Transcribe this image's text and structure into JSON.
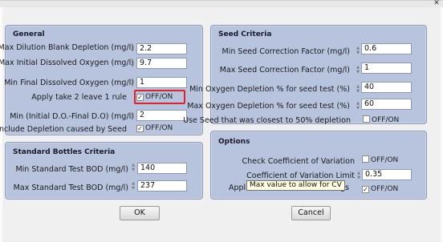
{
  "general": {
    "title": "General",
    "rows": [
      {
        "label": "Max Dilution Blank Depletion (mg/l)",
        "value": "2.2"
      },
      {
        "label": "Max Initial Dissolved Oxygen (mg/l)",
        "value": "9.7"
      },
      {
        "label": "Min Final Dissolved Oxygen (mg/l)",
        "value": "1"
      }
    ],
    "take2_label": "Apply take 2 leave 1 rule",
    "take2_check": "OFF/ON",
    "min_diff_label": "Min (Initial D.O.-Final D.O) (mg/l)",
    "min_diff_value": "2",
    "seed_dep_label": "Include Depletion caused by Seed",
    "seed_dep_check": "OFF/ON"
  },
  "standard": {
    "title": "Standard Bottles Criteria",
    "rows": [
      {
        "label": "Min Standard Test BOD (mg/l)",
        "value": "140"
      },
      {
        "label": "Max Standard Test BOD (mg/l)",
        "value": "237"
      }
    ]
  },
  "seed": {
    "title": "Seed Criteria",
    "rows": [
      {
        "label": "Min Seed Correction Factor (mg/l)",
        "value": "0.6"
      },
      {
        "label": "Max Seed Correction Factor (mg/l)",
        "value": "1"
      },
      {
        "label": "Min Oxygen Depletion % for seed test (%)",
        "value": "40"
      },
      {
        "label": "Max Oxygen Depletion % for seed test (%)",
        "value": "60"
      }
    ],
    "closest_label": "Use Seed that was closest to 50% depletion",
    "closest_check": "OFF/ON"
  },
  "options": {
    "title": "Options",
    "cv_label": "Check Coefficient of Variation",
    "cv_check": "OFF/ON",
    "cv_limit_label": "Coefficient of Variation Limit",
    "cv_limit_value": "0.35",
    "apply_label_start": "Appl",
    "apply_label_end": "gs",
    "apply_check": "OFF/ON",
    "tooltip": "Max value to allow for CV"
  },
  "buttons": {
    "ok": "OK",
    "cancel": "Cancel"
  },
  "close_glyph": "✕",
  "check_glyph": "✓"
}
